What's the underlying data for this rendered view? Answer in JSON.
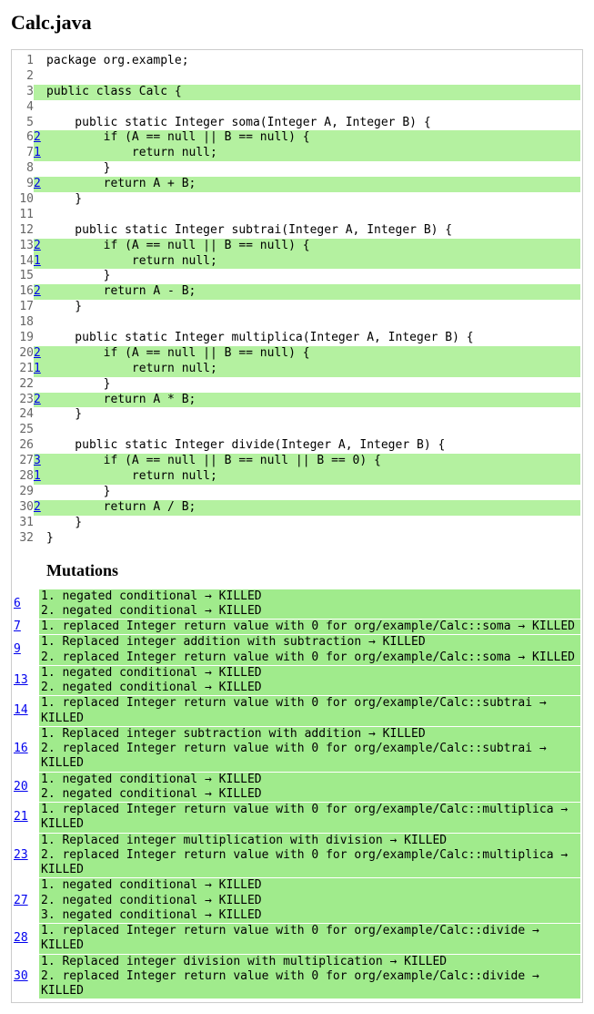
{
  "title": "Calc.java",
  "mutations_heading": "Mutations",
  "code_lines": [
    {
      "n": 1,
      "m": "",
      "covered": false,
      "text": "package org.example;"
    },
    {
      "n": 2,
      "m": "",
      "covered": false,
      "text": ""
    },
    {
      "n": 3,
      "m": "",
      "covered": true,
      "text": "public class Calc {"
    },
    {
      "n": 4,
      "m": "",
      "covered": false,
      "text": ""
    },
    {
      "n": 5,
      "m": "",
      "covered": false,
      "text": "    public static Integer soma(Integer A, Integer B) {"
    },
    {
      "n": 6,
      "m": "2",
      "covered": true,
      "text": "        if (A == null || B == null) {"
    },
    {
      "n": 7,
      "m": "1",
      "covered": true,
      "text": "            return null;"
    },
    {
      "n": 8,
      "m": "",
      "covered": false,
      "text": "        }"
    },
    {
      "n": 9,
      "m": "2",
      "covered": true,
      "text": "        return A + B;"
    },
    {
      "n": 10,
      "m": "",
      "covered": false,
      "text": "    }"
    },
    {
      "n": 11,
      "m": "",
      "covered": false,
      "text": ""
    },
    {
      "n": 12,
      "m": "",
      "covered": false,
      "text": "    public static Integer subtrai(Integer A, Integer B) {"
    },
    {
      "n": 13,
      "m": "2",
      "covered": true,
      "text": "        if (A == null || B == null) {"
    },
    {
      "n": 14,
      "m": "1",
      "covered": true,
      "text": "            return null;"
    },
    {
      "n": 15,
      "m": "",
      "covered": false,
      "text": "        }"
    },
    {
      "n": 16,
      "m": "2",
      "covered": true,
      "text": "        return A - B;"
    },
    {
      "n": 17,
      "m": "",
      "covered": false,
      "text": "    }"
    },
    {
      "n": 18,
      "m": "",
      "covered": false,
      "text": ""
    },
    {
      "n": 19,
      "m": "",
      "covered": false,
      "text": "    public static Integer multiplica(Integer A, Integer B) {"
    },
    {
      "n": 20,
      "m": "2",
      "covered": true,
      "text": "        if (A == null || B == null) {"
    },
    {
      "n": 21,
      "m": "1",
      "covered": true,
      "text": "            return null;"
    },
    {
      "n": 22,
      "m": "",
      "covered": false,
      "text": "        }"
    },
    {
      "n": 23,
      "m": "2",
      "covered": true,
      "text": "        return A * B;"
    },
    {
      "n": 24,
      "m": "",
      "covered": false,
      "text": "    }"
    },
    {
      "n": 25,
      "m": "",
      "covered": false,
      "text": ""
    },
    {
      "n": 26,
      "m": "",
      "covered": false,
      "text": "    public static Integer divide(Integer A, Integer B) {"
    },
    {
      "n": 27,
      "m": "3",
      "covered": true,
      "text": "        if (A == null || B == null || B == 0) {"
    },
    {
      "n": 28,
      "m": "1",
      "covered": true,
      "text": "            return null;"
    },
    {
      "n": 29,
      "m": "",
      "covered": false,
      "text": "        }"
    },
    {
      "n": 30,
      "m": "2",
      "covered": true,
      "text": "        return A / B;"
    },
    {
      "n": 31,
      "m": "",
      "covered": false,
      "text": "    }"
    },
    {
      "n": 32,
      "m": "",
      "covered": false,
      "text": "}"
    }
  ],
  "mutations": [
    {
      "line": "6",
      "items": [
        "1. negated conditional → KILLED",
        "2. negated conditional → KILLED"
      ]
    },
    {
      "line": "7",
      "items": [
        "1. replaced Integer return value with 0 for org/example/Calc::soma → KILLED"
      ]
    },
    {
      "line": "9",
      "items": [
        "1. Replaced integer addition with subtraction → KILLED",
        "2. replaced Integer return value with 0 for org/example/Calc::soma → KILLED"
      ]
    },
    {
      "line": "13",
      "items": [
        "1. negated conditional → KILLED",
        "2. negated conditional → KILLED"
      ]
    },
    {
      "line": "14",
      "items": [
        "1. replaced Integer return value with 0 for org/example/Calc::subtrai → KILLED"
      ]
    },
    {
      "line": "16",
      "items": [
        "1. Replaced integer subtraction with addition → KILLED",
        "2. replaced Integer return value with 0 for org/example/Calc::subtrai → KILLED"
      ]
    },
    {
      "line": "20",
      "items": [
        "1. negated conditional → KILLED",
        "2. negated conditional → KILLED"
      ]
    },
    {
      "line": "21",
      "items": [
        "1. replaced Integer return value with 0 for org/example/Calc::multiplica → KILLED"
      ]
    },
    {
      "line": "23",
      "items": [
        "1. Replaced integer multiplication with division → KILLED",
        "2. replaced Integer return value with 0 for org/example/Calc::multiplica → KILLED"
      ]
    },
    {
      "line": "27",
      "items": [
        "1. negated conditional → KILLED",
        "2. negated conditional → KILLED",
        "3. negated conditional → KILLED"
      ]
    },
    {
      "line": "28",
      "items": [
        "1. replaced Integer return value with 0 for org/example/Calc::divide → KILLED"
      ]
    },
    {
      "line": "30",
      "items": [
        "1. Replaced integer division with multiplication → KILLED",
        "2. replaced Integer return value with 0 for org/example/Calc::divide → KILLED"
      ]
    }
  ]
}
